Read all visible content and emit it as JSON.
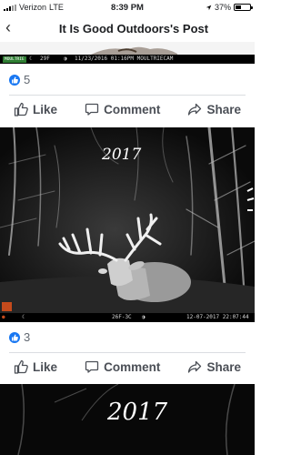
{
  "status_bar": {
    "carrier": "Verizon",
    "network": "LTE",
    "time": "8:39 PM",
    "battery": "37%",
    "battery_level": 0.37
  },
  "header": {
    "back_icon": "chevron-left-icon",
    "title": "It Is Good Outdoors's Post"
  },
  "posts": [
    {
      "cam_bar": {
        "brand": "MOULTRIE",
        "temp": "29F",
        "datetime": "11/23/2016 01:16PM MOULTRIECAM"
      },
      "like_count": "5",
      "actions": {
        "like": "Like",
        "comment": "Comment",
        "share": "Share"
      }
    },
    {
      "overlay_year": "2017",
      "cam_bar": {
        "temp": "26F-3C",
        "datetime": "12-07-2017 22:07:44"
      },
      "like_count": "3",
      "actions": {
        "like": "Like",
        "comment": "Comment",
        "share": "Share"
      }
    },
    {
      "overlay_year": "2017"
    }
  ],
  "colors": {
    "accent": "#1877f2",
    "action_text": "#4b4f56",
    "divider": "#dadde1"
  }
}
